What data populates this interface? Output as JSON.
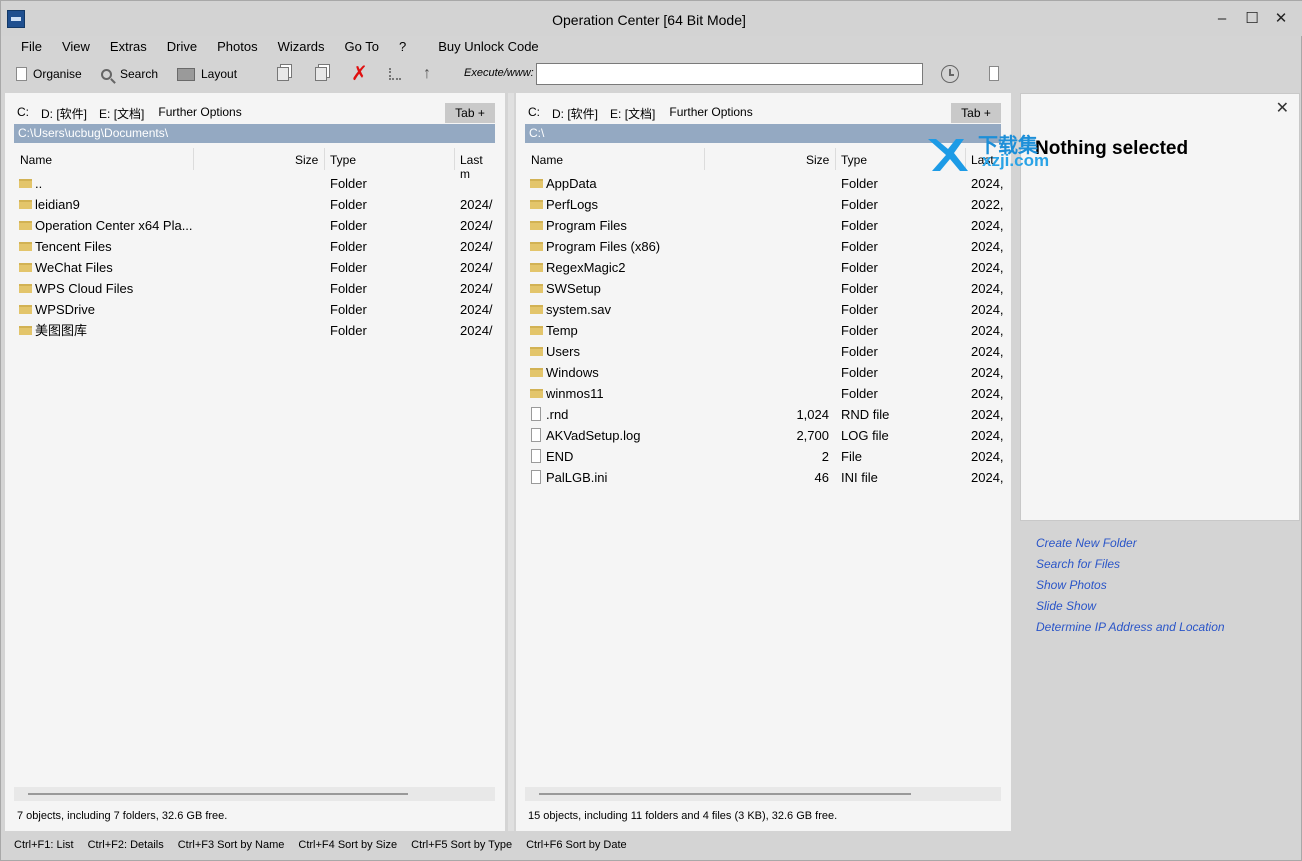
{
  "window": {
    "title": "Operation Center [64 Bit Mode]"
  },
  "menu": [
    "File",
    "View",
    "Extras",
    "Drive",
    "Photos",
    "Wizards",
    "Go To",
    "?",
    "Buy Unlock Code"
  ],
  "toolbar": {
    "organise": "Organise",
    "search": "Search",
    "layout": "Layout",
    "execute_label": "Execute/www:",
    "execute_value": ""
  },
  "left_pane": {
    "drives": [
      "C:",
      "D: [软件]",
      "E: [文档]",
      "Further Options"
    ],
    "tab_button": "Tab +",
    "path": "C:\\Users\\ucbug\\Documents\\",
    "columns": [
      "Name",
      "Size",
      "Type",
      "Last m"
    ],
    "rows": [
      {
        "name": "..",
        "size": "",
        "type": "Folder",
        "date": "",
        "kind": "folder"
      },
      {
        "name": "leidian9",
        "size": "",
        "type": "Folder",
        "date": "2024/",
        "kind": "folder"
      },
      {
        "name": "Operation Center x64 Pla...",
        "size": "",
        "type": "Folder",
        "date": "2024/",
        "kind": "folder"
      },
      {
        "name": "Tencent Files",
        "size": "",
        "type": "Folder",
        "date": "2024/",
        "kind": "folder"
      },
      {
        "name": "WeChat Files",
        "size": "",
        "type": "Folder",
        "date": "2024/",
        "kind": "folder"
      },
      {
        "name": "WPS Cloud Files",
        "size": "",
        "type": "Folder",
        "date": "2024/",
        "kind": "folder"
      },
      {
        "name": "WPSDrive",
        "size": "",
        "type": "Folder",
        "date": "2024/",
        "kind": "folder"
      },
      {
        "name": "美图图库",
        "size": "",
        "type": "Folder",
        "date": "2024/",
        "kind": "folder"
      }
    ],
    "status": "7 objects, including 7 folders, 32.6 GB free."
  },
  "right_pane": {
    "drives": [
      "C:",
      "D: [软件]",
      "E: [文档]",
      "Further Options"
    ],
    "tab_button": "Tab +",
    "path": "C:\\",
    "columns": [
      "Name",
      "Size",
      "Type",
      "Last"
    ],
    "rows": [
      {
        "name": "AppData",
        "size": "",
        "type": "Folder",
        "date": "2024,",
        "kind": "folder"
      },
      {
        "name": "PerfLogs",
        "size": "",
        "type": "Folder",
        "date": "2022,",
        "kind": "folder"
      },
      {
        "name": "Program Files",
        "size": "",
        "type": "Folder",
        "date": "2024,",
        "kind": "folder"
      },
      {
        "name": "Program Files (x86)",
        "size": "",
        "type": "Folder",
        "date": "2024,",
        "kind": "folder"
      },
      {
        "name": "RegexMagic2",
        "size": "",
        "type": "Folder",
        "date": "2024,",
        "kind": "folder"
      },
      {
        "name": "SWSetup",
        "size": "",
        "type": "Folder",
        "date": "2024,",
        "kind": "folder"
      },
      {
        "name": "system.sav",
        "size": "",
        "type": "Folder",
        "date": "2024,",
        "kind": "folder"
      },
      {
        "name": "Temp",
        "size": "",
        "type": "Folder",
        "date": "2024,",
        "kind": "folder"
      },
      {
        "name": "Users",
        "size": "",
        "type": "Folder",
        "date": "2024,",
        "kind": "folder"
      },
      {
        "name": "Windows",
        "size": "",
        "type": "Folder",
        "date": "2024,",
        "kind": "folder"
      },
      {
        "name": "winmos11",
        "size": "",
        "type": "Folder",
        "date": "2024,",
        "kind": "folder"
      },
      {
        "name": ".rnd",
        "size": "1,024",
        "type": "RND file",
        "date": "2024,",
        "kind": "file"
      },
      {
        "name": "AKVadSetup.log",
        "size": "2,700",
        "type": "LOG file",
        "date": "2024,",
        "kind": "file"
      },
      {
        "name": "END",
        "size": "2",
        "type": "File",
        "date": "2024,",
        "kind": "file"
      },
      {
        "name": "PalLGB.ini",
        "size": "46",
        "type": "INI file",
        "date": "2024,",
        "kind": "file"
      }
    ],
    "status": "15 objects, including 11 folders and 4 files (3 KB), 32.6 GB free."
  },
  "side_panel": {
    "title": "Nothing selected",
    "links": [
      "Create New Folder",
      "Search for Files",
      "Show Photos",
      "Slide Show",
      "Determine IP Address and Location"
    ]
  },
  "watermark": {
    "top": "下载集",
    "bottom": "xzji.com"
  },
  "shortcuts": [
    "Ctrl+F1: List",
    "Ctrl+F2: Details",
    "Ctrl+F3 Sort by Name",
    "Ctrl+F4 Sort by Size",
    "Ctrl+F5 Sort by Type",
    "Ctrl+F6 Sort by Date"
  ]
}
